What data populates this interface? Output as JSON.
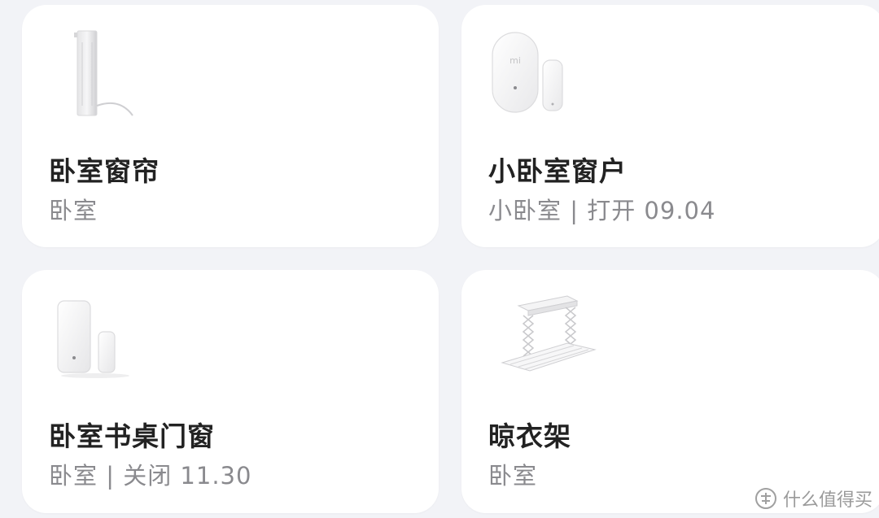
{
  "devices": [
    {
      "name": "卧室窗帘",
      "sub": "卧室",
      "image": "curtain-motor-icon"
    },
    {
      "name": "小卧室窗户",
      "sub": "小卧室 | 打开 09.04",
      "image": "door-window-sensor-icon"
    },
    {
      "name": "卧室书桌门窗",
      "sub": "卧室 | 关闭 11.30",
      "image": "door-window-sensor-icon"
    },
    {
      "name": "晾衣架",
      "sub": "卧室",
      "image": "clothes-rack-icon"
    }
  ],
  "watermark": {
    "text": "什么值得买",
    "icon": "zhi-logo-icon"
  },
  "colors": {
    "background": "#f2f3f7",
    "card": "#ffffff",
    "title": "#222222",
    "subtitle": "#8a8a8e"
  }
}
